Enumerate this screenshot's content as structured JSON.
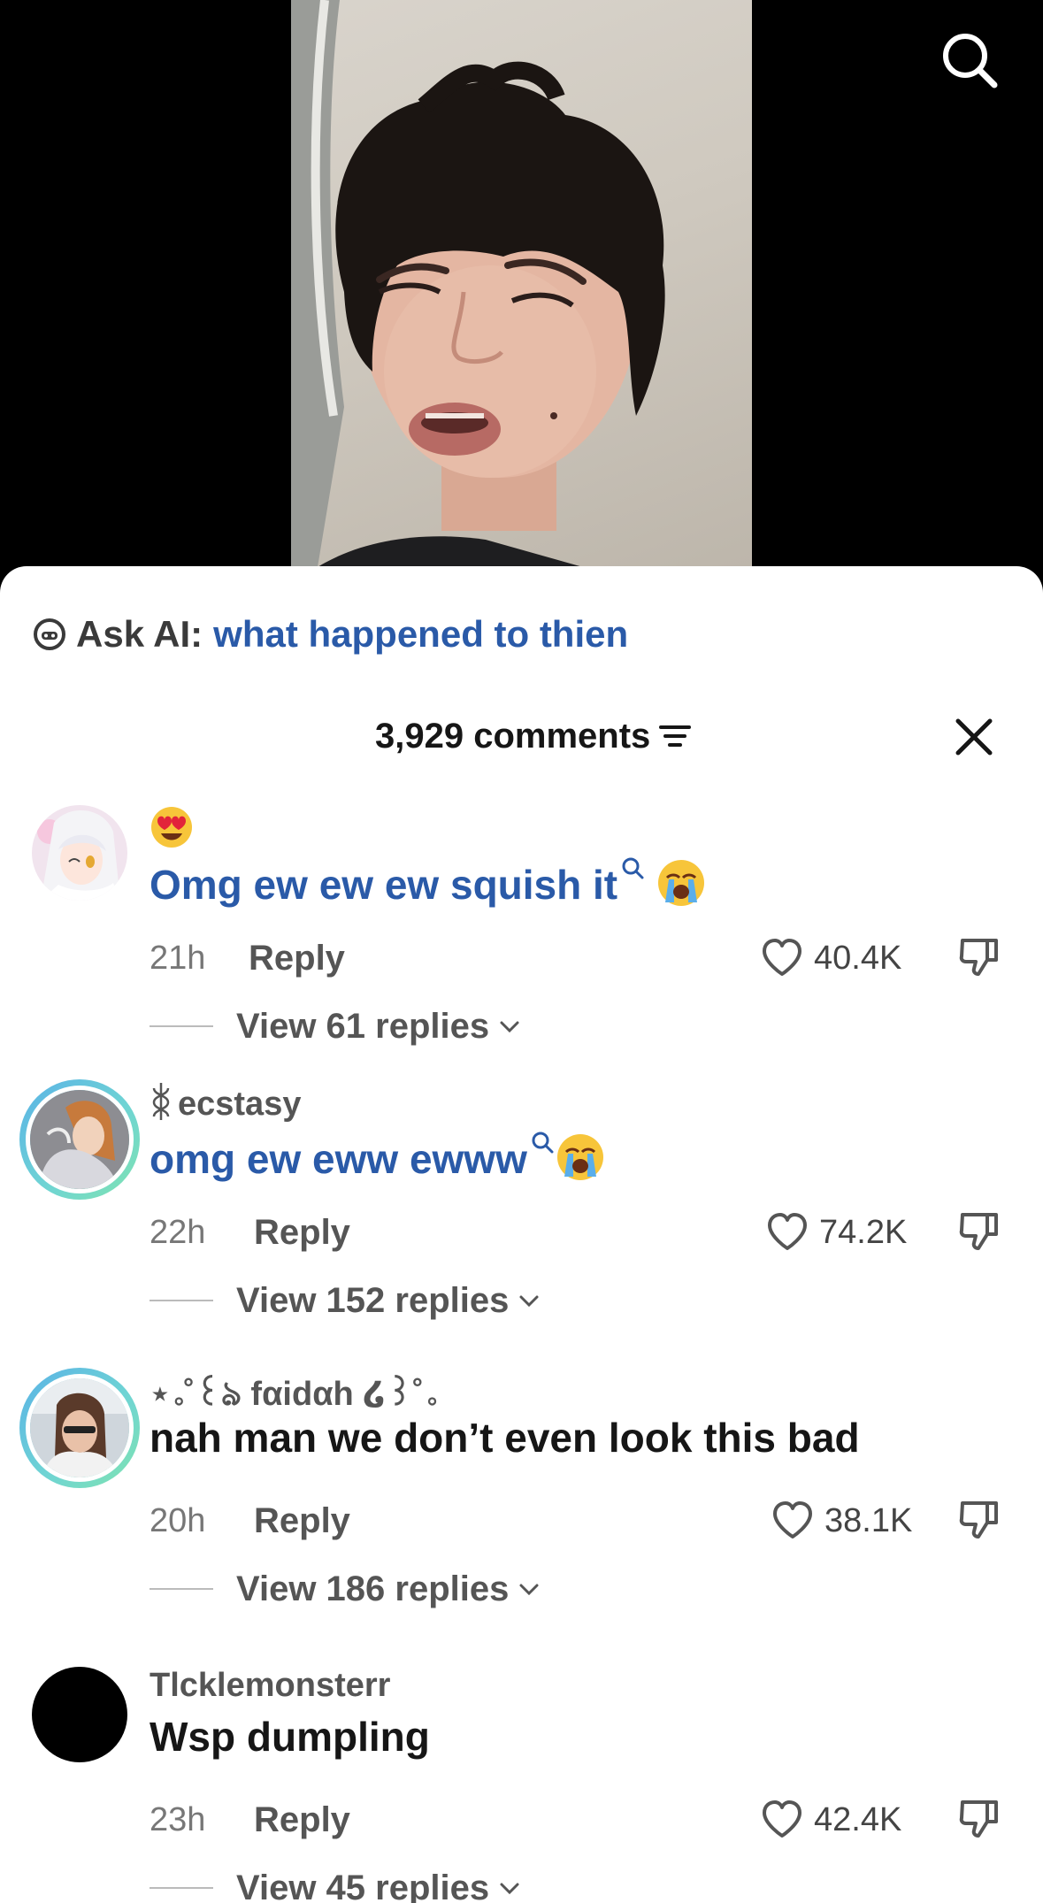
{
  "ask_ai": {
    "label": "Ask AI:",
    "query": "what happened to thien"
  },
  "header": {
    "comment_count": "3,929 comments"
  },
  "comments": [
    {
      "username": "",
      "top_emoji": "heart-eyes-emoji",
      "text": "Omg ew ew ew squish it",
      "text_is_link": true,
      "trailing_emoji": "loudly-crying-emoji",
      "time": "21h",
      "reply_label": "Reply",
      "likes": "40.4K",
      "view_replies": "View 61 replies"
    },
    {
      "username": "ecstasy",
      "text": "omg ew eww ewww",
      "text_is_link": true,
      "trailing_emoji": "loudly-crying-emoji",
      "time": "22h",
      "reply_label": "Reply",
      "likes": "74.2K",
      "view_replies": "View 152 replies"
    },
    {
      "username": "⋆｡˚꒰ঌ fαidαh ໒꒱˚｡",
      "text": "nah man we don’t even look this bad",
      "text_is_link": false,
      "time": "20h",
      "reply_label": "Reply",
      "likes": "38.1K",
      "view_replies": "View 186 replies"
    },
    {
      "username": "Tlcklemonsterr",
      "text": "Wsp dumpling",
      "text_is_link": false,
      "time": "23h",
      "reply_label": "Reply",
      "likes": "42.4K",
      "view_replies": "View 45 replies"
    }
  ],
  "colors": {
    "link_blue": "#2a5aa8",
    "story_ring": "#5ab2e6"
  }
}
